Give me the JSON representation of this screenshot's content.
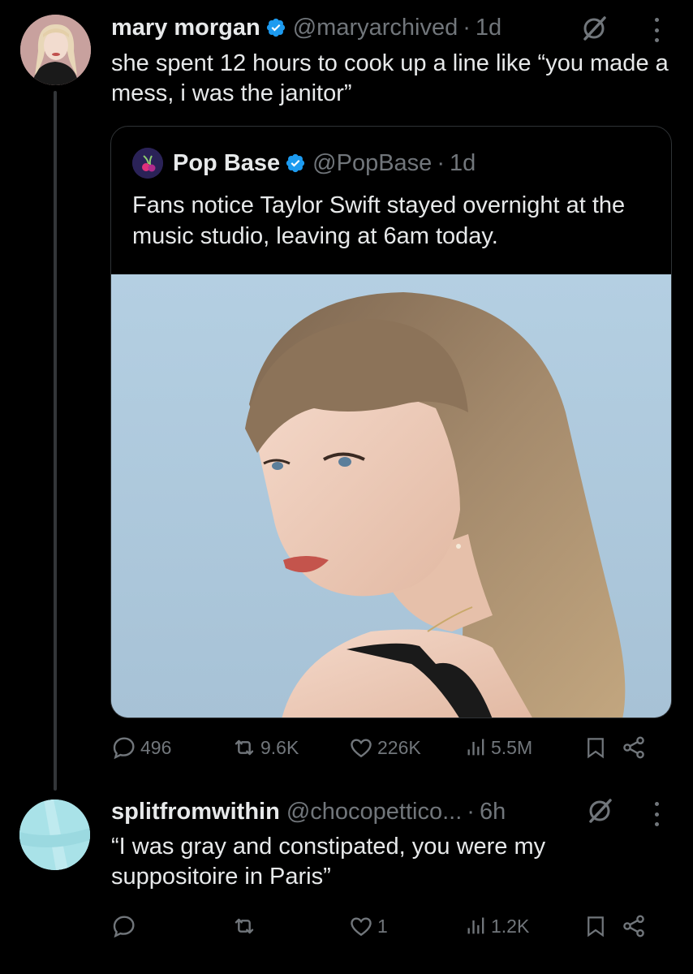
{
  "tweet1": {
    "name": "mary morgan",
    "handle": "@maryarchived",
    "dot": "·",
    "time": "1d",
    "text": "she spent 12 hours to cook up a line like “you made a mess, i was the janitor”",
    "quote": {
      "name": "Pop Base",
      "handle": "@PopBase",
      "dot": "·",
      "time": "1d",
      "text": "Fans notice Taylor Swift stayed overnight at the music studio, leaving at 6am today."
    },
    "stats": {
      "replies": "496",
      "reposts": "9.6K",
      "likes": "226K",
      "views": "5.5M"
    }
  },
  "tweet2": {
    "name": "splitfromwithin",
    "handle": "@chocopettico...",
    "dot": "·",
    "time": "6h",
    "text": "“I was gray and constipated, you were my suppositoire in Paris”",
    "stats": {
      "replies": "",
      "reposts": "",
      "likes": "1",
      "views": "1.2K"
    }
  },
  "colors": {
    "verified": "#1d9bf0",
    "text": "#e7e9ea",
    "muted": "#71767b",
    "background": "#000000"
  }
}
